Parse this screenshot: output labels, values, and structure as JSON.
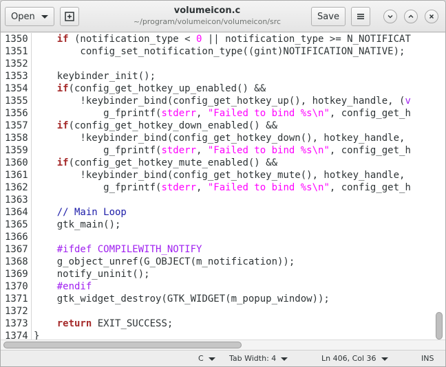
{
  "header": {
    "open_label": "Open",
    "save_label": "Save",
    "title": "volumeicon.c",
    "subtitle": "~/program/volumeicon/volumeicon/src"
  },
  "editor": {
    "lines": [
      {
        "n": "1350",
        "tokens": [
          [
            "",
            "    "
          ],
          [
            "kw",
            "if"
          ],
          [
            "",
            " (notification_type < "
          ],
          [
            "num",
            "0"
          ],
          [
            "",
            " || notification_type >= N_NOTIFICAT"
          ]
        ]
      },
      {
        "n": "1351",
        "tokens": [
          [
            "",
            "        config_set_notification_type((gint)NOTIFICATION_NATIVE);"
          ]
        ]
      },
      {
        "n": "1352",
        "tokens": [
          [
            "",
            ""
          ]
        ]
      },
      {
        "n": "1353",
        "tokens": [
          [
            "",
            "    keybinder_init();"
          ]
        ]
      },
      {
        "n": "1354",
        "tokens": [
          [
            "",
            "    "
          ],
          [
            "kw",
            "if"
          ],
          [
            "",
            "(config_get_hotkey_up_enabled() &&"
          ]
        ]
      },
      {
        "n": "1355",
        "tokens": [
          [
            "",
            "        !keybinder_bind(config_get_hotkey_up(), hotkey_handle, ("
          ],
          [
            "pp",
            "v"
          ]
        ]
      },
      {
        "n": "1356",
        "tokens": [
          [
            "",
            "            g_fprintf("
          ],
          [
            "std",
            "stderr"
          ],
          [
            "",
            ", "
          ],
          [
            "str",
            "\"Failed to bind %s\\n\""
          ],
          [
            "",
            ", config_get_h"
          ]
        ]
      },
      {
        "n": "1357",
        "tokens": [
          [
            "",
            "    "
          ],
          [
            "kw",
            "if"
          ],
          [
            "",
            "(config_get_hotkey_down_enabled() &&"
          ]
        ]
      },
      {
        "n": "1358",
        "tokens": [
          [
            "",
            "        !keybinder_bind(config_get_hotkey_down(), hotkey_handle,"
          ]
        ]
      },
      {
        "n": "1359",
        "tokens": [
          [
            "",
            "            g_fprintf("
          ],
          [
            "std",
            "stderr"
          ],
          [
            "",
            ", "
          ],
          [
            "str",
            "\"Failed to bind %s\\n\""
          ],
          [
            "",
            ", config_get_h"
          ]
        ]
      },
      {
        "n": "1360",
        "tokens": [
          [
            "",
            "    "
          ],
          [
            "kw",
            "if"
          ],
          [
            "",
            "(config_get_hotkey_mute_enabled() &&"
          ]
        ]
      },
      {
        "n": "1361",
        "tokens": [
          [
            "",
            "        !keybinder_bind(config_get_hotkey_mute(), hotkey_handle,"
          ]
        ]
      },
      {
        "n": "1362",
        "tokens": [
          [
            "",
            "            g_fprintf("
          ],
          [
            "std",
            "stderr"
          ],
          [
            "",
            ", "
          ],
          [
            "str",
            "\"Failed to bind %s\\n\""
          ],
          [
            "",
            ", config_get_h"
          ]
        ]
      },
      {
        "n": "1363",
        "tokens": [
          [
            "",
            ""
          ]
        ]
      },
      {
        "n": "1364",
        "tokens": [
          [
            "",
            "    "
          ],
          [
            "cmt",
            "// Main Loop"
          ]
        ]
      },
      {
        "n": "1365",
        "tokens": [
          [
            "",
            "    gtk_main();"
          ]
        ]
      },
      {
        "n": "1366",
        "tokens": [
          [
            "",
            ""
          ]
        ]
      },
      {
        "n": "1367",
        "tokens": [
          [
            "",
            "    "
          ],
          [
            "pp",
            "#ifdef COMPILEWITH_NOTIFY"
          ]
        ]
      },
      {
        "n": "1368",
        "tokens": [
          [
            "",
            "    g_object_unref(G_OBJECT(m_notification));"
          ]
        ]
      },
      {
        "n": "1369",
        "tokens": [
          [
            "",
            "    notify_uninit();"
          ]
        ]
      },
      {
        "n": "1370",
        "tokens": [
          [
            "",
            "    "
          ],
          [
            "pp",
            "#endif"
          ]
        ]
      },
      {
        "n": "1371",
        "tokens": [
          [
            "",
            "    gtk_widget_destroy(GTK_WIDGET(m_popup_window));"
          ]
        ]
      },
      {
        "n": "1372",
        "tokens": [
          [
            "",
            ""
          ]
        ]
      },
      {
        "n": "1373",
        "tokens": [
          [
            "",
            "    "
          ],
          [
            "kw",
            "return"
          ],
          [
            "",
            " EXIT_SUCCESS;"
          ]
        ]
      },
      {
        "n": "1374",
        "tokens": [
          [
            "",
            "}"
          ]
        ]
      }
    ]
  },
  "statusbar": {
    "language": "C",
    "tab_width": "Tab Width: 4",
    "position": "Ln 406, Col 36",
    "mode": "INS"
  },
  "icons": {
    "new_tab": "new-tab-icon",
    "menu": "hamburger-menu-icon",
    "minimize": "minimize-icon",
    "maximize": "maximize-icon",
    "close": "close-icon"
  }
}
